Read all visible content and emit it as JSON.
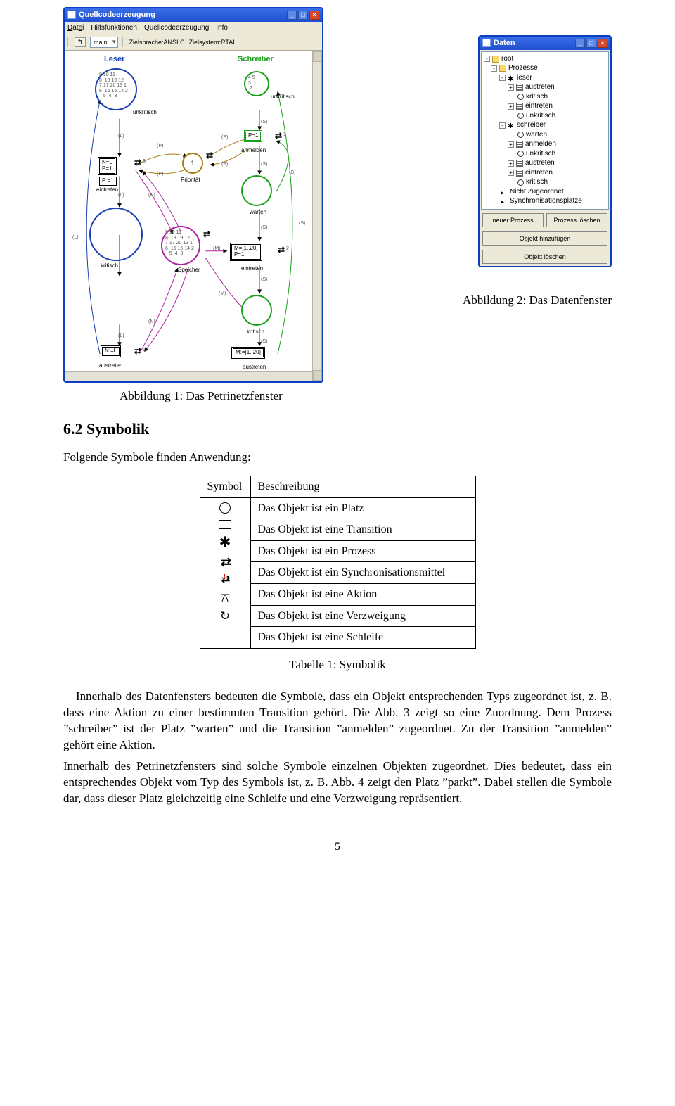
{
  "captions": {
    "fig1": "Abbildung 1: Das Petrinetzfenster",
    "fig2": "Abbildung 2: Das Datenfenster",
    "tab1": "Tabelle 1: Symbolik"
  },
  "section": {
    "num_title": "6.2  Symbolik",
    "intro": "Folgende Symbole finden Anwendung:"
  },
  "table": {
    "hdr_symbol": "Symbol",
    "hdr_desc": "Beschreibung",
    "rows": [
      {
        "desc": "Das Objekt ist ein Platz"
      },
      {
        "desc": "Das Objekt ist eine Transition"
      },
      {
        "desc": "Das Objekt ist ein Prozess"
      },
      {
        "desc": "Das Objekt ist ein Synchronisationsmittel"
      },
      {
        "desc": "Das Objekt ist eine Aktion"
      },
      {
        "desc": "Das Objekt ist eine Verzweigung"
      },
      {
        "desc": "Das Objekt ist eine Schleife"
      }
    ]
  },
  "paragraphs": {
    "p1": "Innerhalb des Datenfensters bedeuten die Symbole, dass ein Objekt entsprechenden Typs zugeordnet ist, z. B. dass eine Aktion zu einer bestimmten Transition gehört. Die Abb. 3 zeigt so eine Zuordnung. Dem Prozess ”schreiber” ist der Platz ”warten” und die Transition ”anmelden” zugeordnet. Zu der Transition ”anmelden” gehört eine Aktion.",
    "p2": "Innerhalb des Petrinetzfensters sind solche Symbole einzelnen Objekten zugeordnet. Dies bedeutet, dass ein entsprechendes Objekt vom Typ des Symbols ist, z. B. Abb. 4 zeigt den Platz ”parkt”. Dabei stellen die Symbole dar, dass dieser Platz gleichzeitig eine Schleife und eine Verzweigung repräsentiert."
  },
  "page_num": "5",
  "petrinetz": {
    "title": "Quellcodeerzeugung",
    "menu": [
      "Datei",
      "Hilfsfunktionen",
      "Quellcodeerzeugung",
      "Info"
    ],
    "combo": "main",
    "lbl_ziel": "Zielsprache:ANSI C",
    "lbl_sys": "Zielsystem:RTAI",
    "leser": "Leser",
    "schreiber": "Schreiber",
    "labels": {
      "unkritisch": "unkritisch",
      "eintreten": "eintreten",
      "kritisch": "kritisch",
      "austreten": "austreten",
      "prioritaet": "Priorität",
      "speicher": "Speicher",
      "anmelden": "anmelden",
      "warten": "warten",
      "p1": "P=1",
      "np": "N=L\nP=1",
      "nl": "N:=L",
      "pv1": "P:=1",
      "m120": "M=[1..20]\nP=1",
      "m20": "M:=[1..20]",
      "tokenset": "9 10 11\n8  18 19 12\n7 17 20 13 1\n6  16 15 14 2\n   5  4  3"
    }
  },
  "daten": {
    "title": "Daten",
    "tree": [
      {
        "lvl": 0,
        "tw": "-",
        "ico": "folder",
        "txt": "root"
      },
      {
        "lvl": 1,
        "tw": "-",
        "ico": "folder",
        "txt": "Prozesse"
      },
      {
        "lvl": 2,
        "tw": "-",
        "ico": "gear",
        "txt": "leser"
      },
      {
        "lvl": 3,
        "tw": "+",
        "ico": "mesh",
        "txt": "austreten"
      },
      {
        "lvl": 3,
        "tw": "",
        "ico": "circle",
        "txt": "kritisch"
      },
      {
        "lvl": 3,
        "tw": "+",
        "ico": "mesh",
        "txt": "eintreten"
      },
      {
        "lvl": 3,
        "tw": "",
        "ico": "circle",
        "txt": "unkritisch"
      },
      {
        "lvl": 2,
        "tw": "-",
        "ico": "gear",
        "txt": "schreiber"
      },
      {
        "lvl": 3,
        "tw": "",
        "ico": "circle",
        "txt": "warten"
      },
      {
        "lvl": 3,
        "tw": "+",
        "ico": "mesh",
        "txt": "anmelden"
      },
      {
        "lvl": 3,
        "tw": "",
        "ico": "circle",
        "txt": "unkritisch"
      },
      {
        "lvl": 3,
        "tw": "+",
        "ico": "mesh",
        "txt": "austreten"
      },
      {
        "lvl": 3,
        "tw": "+",
        "ico": "mesh",
        "txt": "eintreten"
      },
      {
        "lvl": 3,
        "tw": "",
        "ico": "circle",
        "txt": "kritisch"
      },
      {
        "lvl": 1,
        "tw": "",
        "ico": "tri",
        "txt": "Nicht Zugeordnet"
      },
      {
        "lvl": 1,
        "tw": "",
        "ico": "tri",
        "txt": "Synchronisationsplätze"
      }
    ],
    "buttons": {
      "np": "neuer Prozess",
      "pl": "Prozess löschen",
      "oh": "Objekt hinzufügen",
      "ol": "Objekt löschen"
    }
  }
}
